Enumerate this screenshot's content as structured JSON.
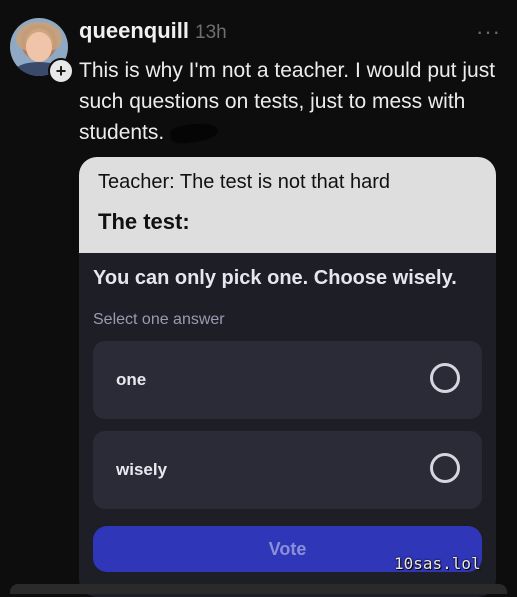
{
  "post": {
    "username": "queenquill",
    "timestamp": "13h",
    "more_icon": "more-dots-icon",
    "follow_icon": "plus-icon",
    "text": "This is why I'm not a teacher. I would put just such questions on tests, just to mess with students."
  },
  "meme": {
    "line1": "Teacher: The test is not that hard",
    "line2": "The test:"
  },
  "poll": {
    "question": "You can only pick one. Choose wisely.",
    "instruction": "Select one answer",
    "options": [
      {
        "label": "one"
      },
      {
        "label": "wisely"
      }
    ],
    "vote_label": "Vote"
  },
  "watermark": "10sas.lol",
  "colors": {
    "background": "#0d0d0d",
    "poll_bg": "#1d1e26",
    "option_bg": "#2a2b36",
    "vote_button": "#3036b8"
  }
}
